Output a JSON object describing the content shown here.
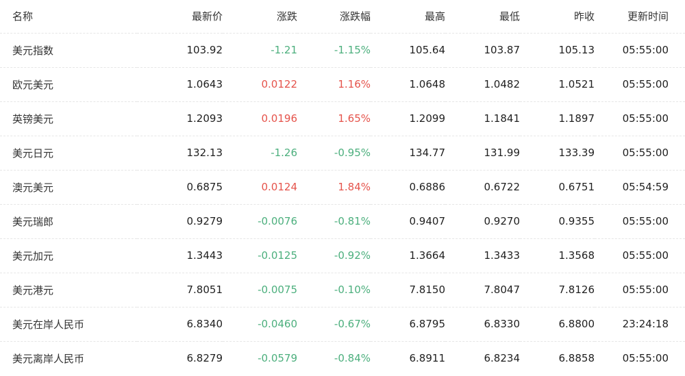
{
  "columns": {
    "name": "名称",
    "last": "最新价",
    "change": "涨跌",
    "pct": "涨跌幅",
    "high": "最高",
    "low": "最低",
    "prev_close": "昨收",
    "time": "更新时间"
  },
  "colors": {
    "up": "#e5534b",
    "down": "#4caf7d"
  },
  "rows": [
    {
      "name": "美元指数",
      "last": "103.92",
      "change": "-1.21",
      "pct": "-1.15%",
      "high": "105.64",
      "low": "103.87",
      "prev_close": "105.13",
      "time": "05:55:00",
      "dir": "down"
    },
    {
      "name": "欧元美元",
      "last": "1.0643",
      "change": "0.0122",
      "pct": "1.16%",
      "high": "1.0648",
      "low": "1.0482",
      "prev_close": "1.0521",
      "time": "05:55:00",
      "dir": "up"
    },
    {
      "name": "英镑美元",
      "last": "1.2093",
      "change": "0.0196",
      "pct": "1.65%",
      "high": "1.2099",
      "low": "1.1841",
      "prev_close": "1.1897",
      "time": "05:55:00",
      "dir": "up"
    },
    {
      "name": "美元日元",
      "last": "132.13",
      "change": "-1.26",
      "pct": "-0.95%",
      "high": "134.77",
      "low": "131.99",
      "prev_close": "133.39",
      "time": "05:55:00",
      "dir": "down"
    },
    {
      "name": "澳元美元",
      "last": "0.6875",
      "change": "0.0124",
      "pct": "1.84%",
      "high": "0.6886",
      "low": "0.6722",
      "prev_close": "0.6751",
      "time": "05:54:59",
      "dir": "up"
    },
    {
      "name": "美元瑞郎",
      "last": "0.9279",
      "change": "-0.0076",
      "pct": "-0.81%",
      "high": "0.9407",
      "low": "0.9270",
      "prev_close": "0.9355",
      "time": "05:55:00",
      "dir": "down"
    },
    {
      "name": "美元加元",
      "last": "1.3443",
      "change": "-0.0125",
      "pct": "-0.92%",
      "high": "1.3664",
      "low": "1.3433",
      "prev_close": "1.3568",
      "time": "05:55:00",
      "dir": "down"
    },
    {
      "name": "美元港元",
      "last": "7.8051",
      "change": "-0.0075",
      "pct": "-0.10%",
      "high": "7.8150",
      "low": "7.8047",
      "prev_close": "7.8126",
      "time": "05:55:00",
      "dir": "down"
    },
    {
      "name": "美元在岸人民币",
      "last": "6.8340",
      "change": "-0.0460",
      "pct": "-0.67%",
      "high": "6.8795",
      "low": "6.8330",
      "prev_close": "6.8800",
      "time": "23:24:18",
      "dir": "down"
    },
    {
      "name": "美元离岸人民币",
      "last": "6.8279",
      "change": "-0.0579",
      "pct": "-0.84%",
      "high": "6.8911",
      "low": "6.8234",
      "prev_close": "6.8858",
      "time": "05:55:00",
      "dir": "down"
    }
  ]
}
